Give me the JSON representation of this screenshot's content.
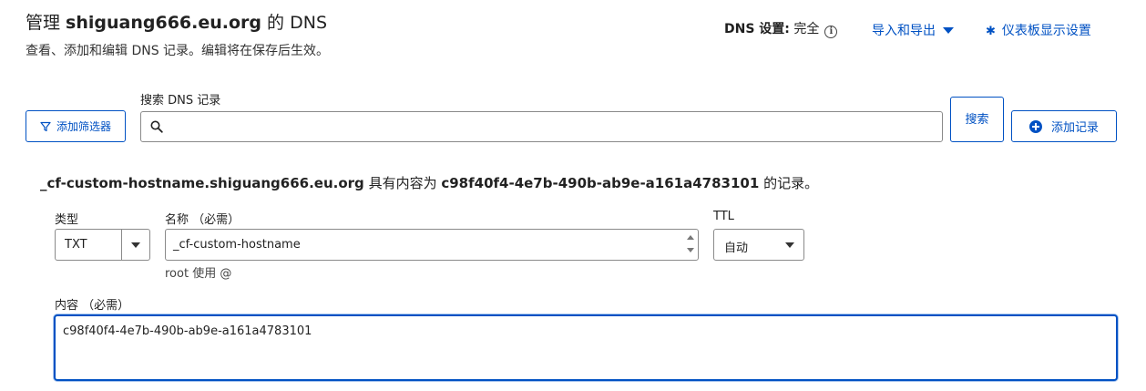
{
  "header": {
    "title_prefix": "管理 ",
    "domain": "shiguang666.eu.org",
    "title_suffix": " 的 DNS",
    "subtitle": "查看、添加和编辑 DNS 记录。编辑将在保存后生效。",
    "dns_setting_label": "DNS 设置:",
    "dns_setting_value": "完全",
    "info_icon": "i",
    "import_export_label": "导入和导出",
    "dashboard_settings_label": "仪表板显示设置"
  },
  "toolbar": {
    "filter_label": "添加筛选器",
    "search_label": "搜索 DNS 记录",
    "search_value": "",
    "search_button": "搜索",
    "add_record_label": "添加记录"
  },
  "record": {
    "host": "_cf-custom-hostname.shiguang666.eu.org",
    "middle_text": " 具有内容为 ",
    "content_value": "c98f40f4-4e7b-490b-ab9e-a161a4783101",
    "end_text": " 的记录。"
  },
  "form": {
    "type_label": "类型",
    "type_value": "TXT",
    "name_label": "名称 （必需）",
    "name_value": "_cf-custom-hostname",
    "name_hint": "root 使用 @",
    "ttl_label": "TTL",
    "ttl_value": "自动",
    "content_label": "内容 （必需）",
    "content_value": "c98f40f4-4e7b-490b-ab9e-a161a4783101"
  },
  "colors": {
    "accent": "#0051c3",
    "border": "#8a8a8a",
    "text": "#222222"
  },
  "icons": [
    "info-icon",
    "caret-down-icon",
    "gear-icon",
    "filter-icon",
    "search-icon",
    "plus-circle-icon",
    "chevron-down-icon",
    "spinner-up-icon",
    "spinner-down-icon"
  ]
}
